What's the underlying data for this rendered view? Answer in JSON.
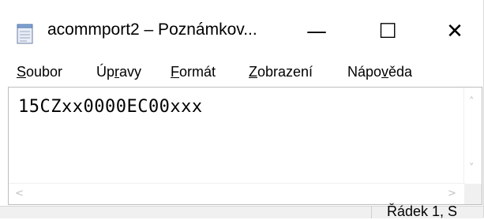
{
  "window": {
    "title": "acommport2 – Poznámkov...",
    "icon": "notepad-icon",
    "controls": {
      "minimize": "—",
      "maximize": "☐",
      "close": "✕"
    }
  },
  "menu": [
    {
      "pre": "",
      "u": "S",
      "post": "oubor"
    },
    {
      "pre": "Úp",
      "u": "r",
      "post": "avy"
    },
    {
      "pre": "",
      "u": "F",
      "post": "ormát"
    },
    {
      "pre": "",
      "u": "Z",
      "post": "obrazení"
    },
    {
      "pre": "Nápo",
      "u": "v",
      "post": "ěda"
    }
  ],
  "editor": {
    "content": "15CZxx0000EC00xxx"
  },
  "scrollbars": {
    "up": "˄",
    "down": "˅",
    "left": "<",
    "right": ">"
  },
  "status": {
    "position": "Řádek 1, S"
  }
}
